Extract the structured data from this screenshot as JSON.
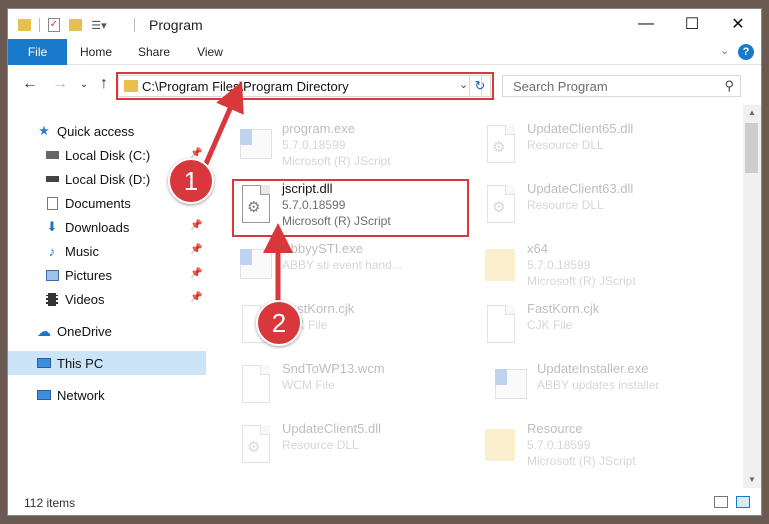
{
  "window": {
    "title": "Program"
  },
  "ribbon": {
    "tabs": [
      "File",
      "Home",
      "Share",
      "View"
    ]
  },
  "address": {
    "path": "C:\\Program Files\\Program Directory"
  },
  "search": {
    "placeholder": "Search Program"
  },
  "sidebar": {
    "items": [
      {
        "label": "Quick access"
      },
      {
        "label": "Local Disk (C:)"
      },
      {
        "label": "Local Disk (D:)"
      },
      {
        "label": "Documents"
      },
      {
        "label": "Downloads"
      },
      {
        "label": "Music"
      },
      {
        "label": "Pictures"
      },
      {
        "label": "Videos"
      },
      {
        "label": "OneDrive"
      },
      {
        "label": "This PC"
      },
      {
        "label": "Network"
      }
    ]
  },
  "files": [
    {
      "name": "program.exe",
      "l1": "5.7.0.18599",
      "l2": "Microsoft (R) JScript"
    },
    {
      "name": "UpdateClient65.dll",
      "l1": "Resource DLL",
      "l2": ""
    },
    {
      "name": "jscript.dll",
      "l1": "5.7.0.18599",
      "l2": "Microsoft (R) JScript"
    },
    {
      "name": "UpdateClient63.dll",
      "l1": "Resource DLL",
      "l2": ""
    },
    {
      "name": "AbbyySTI.exe",
      "l1": "ABBY sti event hand...",
      "l2": ""
    },
    {
      "name": "x64",
      "l1": "5.7.0.18599",
      "l2": "Microsoft (R) JScript"
    },
    {
      "name": "FastKorn.cjk",
      "l1": "CJK File",
      "l2": ""
    },
    {
      "name": "FastKorn.cjk",
      "l1": "CJK File",
      "l2": ""
    },
    {
      "name": "SndToWP13.wcm",
      "l1": "WCM File",
      "l2": ""
    },
    {
      "name": "UpdateInstaller.exe",
      "l1": "ABBY updates installer",
      "l2": ""
    },
    {
      "name": "UpdateClient5.dll",
      "l1": "Resource DLL",
      "l2": ""
    },
    {
      "name": "Resource",
      "l1": "5.7.0.18599",
      "l2": "Microsoft (R) JScript"
    }
  ],
  "status": {
    "count": "112 items"
  },
  "annotations": {
    "badge1": "1",
    "badge2": "2"
  },
  "colors": {
    "accent": "#1979ca",
    "highlight": "#d8373c",
    "selected": "#cce4f7"
  }
}
